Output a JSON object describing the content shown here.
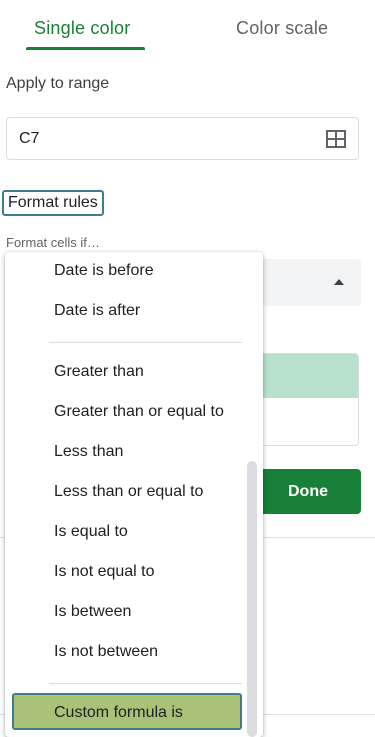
{
  "tabs": {
    "single_color": "Single color",
    "color_scale": "Color scale"
  },
  "apply_to_range": {
    "label": "Apply to range",
    "value": "C7",
    "icon": "grid-icon"
  },
  "format_rules": {
    "label": "Format rules",
    "condition_label": "Format cells if…",
    "select_icon": "caret-up-icon"
  },
  "done_label": "Done",
  "colors": {
    "accent": "#188038",
    "preview_fill": "#b7e1cd",
    "selected_item_bg": "#a8c378",
    "focus_outline": "#3f7c8c"
  },
  "menu": {
    "items": [
      "Date is before",
      "Date is after",
      "Greater than",
      "Greater than or equal to",
      "Less than",
      "Less than or equal to",
      "Is equal to",
      "Is not equal to",
      "Is between",
      "Is not between",
      "Custom formula is"
    ],
    "selected": "Custom formula is"
  }
}
